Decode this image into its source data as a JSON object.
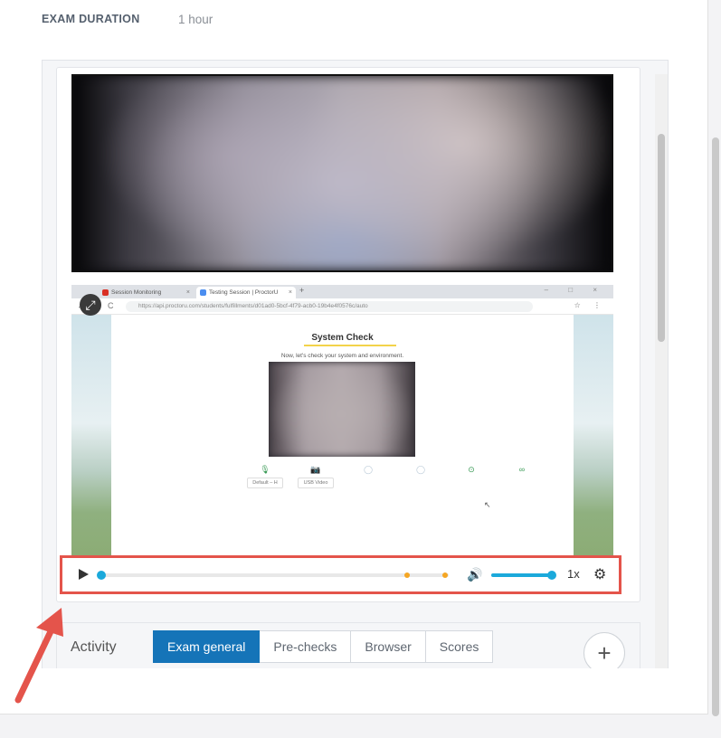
{
  "exam_duration": {
    "label": "EXAM DURATION",
    "value": "1 hour"
  },
  "screen_capture": {
    "browser_tabs": [
      {
        "title": "Session Monitoring",
        "close": "×",
        "dot_color": "#d93025"
      },
      {
        "title": "Testing Session | ProctorU",
        "close": "×",
        "dot_color": "#4b8ef0"
      }
    ],
    "new_tab": "+",
    "window_controls": "– □ ×",
    "nav": {
      "back": "←",
      "forward": "→",
      "reload": "C"
    },
    "url": "https://api.proctoru.com/students/fulfillments/d01ad0-5bcf-4f79-acb0-19b4e4f0576c/auto",
    "toolbar_icons": "☆ ⋮",
    "page_title": "System Check",
    "page_subtitle": "Now, let's check your system and environment.",
    "checks": [
      {
        "name": "microphone",
        "icon": "🎙",
        "select": "Default – H"
      },
      {
        "name": "camera",
        "icon": "📷",
        "select": "USB Video"
      },
      {
        "name": "check-3",
        "icon": "◯",
        "select": ""
      },
      {
        "name": "check-4",
        "icon": "◯",
        "select": ""
      },
      {
        "name": "check-5",
        "icon": "⊙",
        "select": ""
      },
      {
        "name": "check-6",
        "icon": "∞",
        "select": ""
      }
    ],
    "cursor": "↖"
  },
  "expand_icon": "⤢",
  "player": {
    "progress_fraction": 0.0,
    "event_markers": [
      0.88,
      0.99
    ],
    "volume_fraction": 0.96,
    "speed": "1x",
    "volume_icon": "🔊",
    "settings_icon": "⚙",
    "accent_color": "#1ba9db",
    "marker_color": "#f5a623"
  },
  "activity": {
    "label": "Activity",
    "tabs": [
      {
        "label": "Exam general",
        "active": true
      },
      {
        "label": "Pre-checks",
        "active": false
      },
      {
        "label": "Browser",
        "active": false
      },
      {
        "label": "Scores",
        "active": false
      }
    ],
    "add_icon": "+"
  },
  "annotation": {
    "highlight_color": "#e4544b"
  }
}
